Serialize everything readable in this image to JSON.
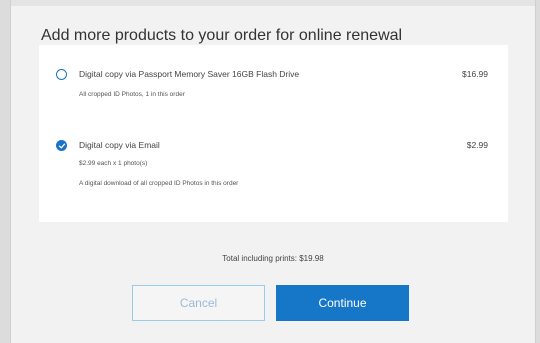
{
  "dialog": {
    "title": "Add more products to your order for online renewal"
  },
  "options": [
    {
      "label": "Digital copy via Passport Memory Saver 16GB Flash Drive",
      "price": "$16.99",
      "details": [
        "All cropped ID Photos, 1 in this order"
      ],
      "selected": false
    },
    {
      "label": "Digital copy via Email",
      "price": "$2.99",
      "details": [
        "$2.99 each x 1 photo(s)",
        "A digital download of all cropped ID Photos in this order"
      ],
      "selected": true
    }
  ],
  "total": {
    "text": "Total including prints:  $19.98"
  },
  "buttons": {
    "cancel": "Cancel",
    "continue": "Continue"
  },
  "colors": {
    "accent": "#1677c8",
    "cancel_border": "#9ccbe9"
  }
}
